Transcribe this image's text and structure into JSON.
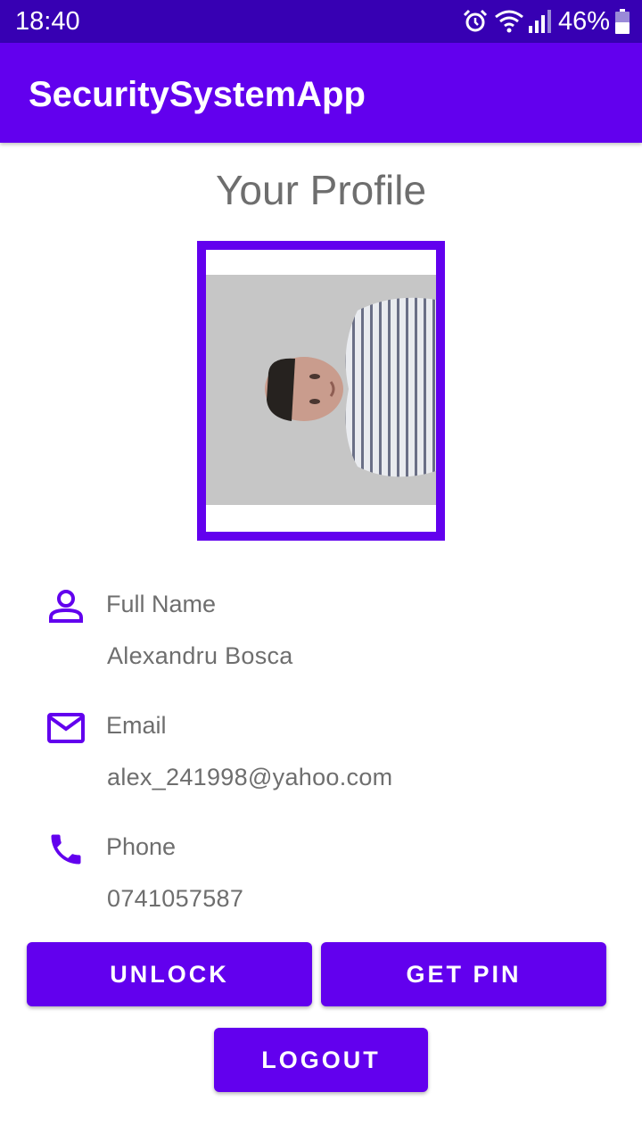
{
  "status_bar": {
    "time": "18:40",
    "battery": "46%",
    "icons": [
      "alarm-icon",
      "wifi-icon",
      "signal-icon",
      "battery-icon"
    ]
  },
  "app_bar": {
    "title": "SecuritySystemApp"
  },
  "profile": {
    "title": "Your Profile",
    "photo_icon": "profile-photo",
    "fields": [
      {
        "icon": "person-icon",
        "label": "Full Name",
        "value": "Alexandru Bosca"
      },
      {
        "icon": "email-icon",
        "label": "Email",
        "value": "alex_241998@yahoo.com"
      },
      {
        "icon": "phone-icon",
        "label": "Phone",
        "value": "0741057587"
      }
    ]
  },
  "buttons": {
    "unlock": "UNLOCK",
    "get_pin": "GET PIN",
    "logout": "LOGOUT"
  },
  "colors": {
    "primary": "#6200ee",
    "primary_dark": "#3700b3",
    "text_secondary": "#6e6e6e"
  }
}
